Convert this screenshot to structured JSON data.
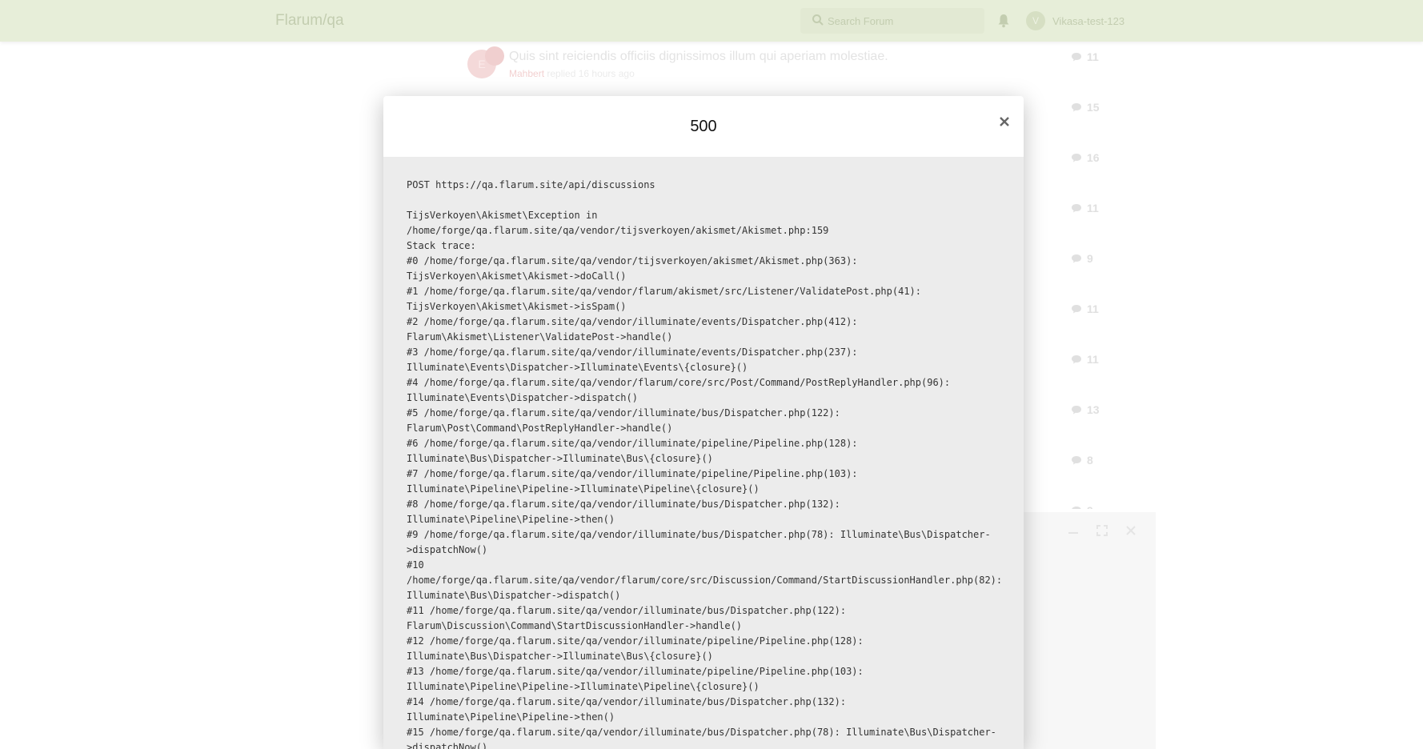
{
  "header": {
    "logo": "Flarum/qa",
    "search_placeholder": "Search Forum",
    "avatar_letter": "V",
    "username": "Vikasa-test-123"
  },
  "background_list": {
    "first_discussion": {
      "avatar_letter": "E",
      "title": "Quis sint reiciendis officiis dignissimos illum qui aperiam molestiae.",
      "tag": "Mahbert",
      "meta": " replied 16 hours ago"
    },
    "reply_counts": [
      "11",
      "15",
      "16",
      "11",
      "9",
      "11",
      "11",
      "13",
      "8",
      "9"
    ]
  },
  "modal": {
    "title": "500",
    "request": "POST https://qa.flarum.site/api/discussions",
    "trace_lines": [
      "TijsVerkoyen\\Akismet\\Exception in",
      "/home/forge/qa.flarum.site/qa/vendor/tijsverkoyen/akismet/Akismet.php:159",
      "Stack trace:",
      "#0 /home/forge/qa.flarum.site/qa/vendor/tijsverkoyen/akismet/Akismet.php(363):",
      "TijsVerkoyen\\Akismet\\Akismet->doCall()",
      "#1 /home/forge/qa.flarum.site/qa/vendor/flarum/akismet/src/Listener/ValidatePost.php(41):",
      "TijsVerkoyen\\Akismet\\Akismet->isSpam()",
      "#2 /home/forge/qa.flarum.site/qa/vendor/illuminate/events/Dispatcher.php(412):",
      "Flarum\\Akismet\\Listener\\ValidatePost->handle()",
      "#3 /home/forge/qa.flarum.site/qa/vendor/illuminate/events/Dispatcher.php(237):",
      "Illuminate\\Events\\Dispatcher->Illuminate\\Events\\{closure}()",
      "#4 /home/forge/qa.flarum.site/qa/vendor/flarum/core/src/Post/Command/PostReplyHandler.php(96):",
      "Illuminate\\Events\\Dispatcher->dispatch()",
      "#5 /home/forge/qa.flarum.site/qa/vendor/illuminate/bus/Dispatcher.php(122):",
      "Flarum\\Post\\Command\\PostReplyHandler->handle()",
      "#6 /home/forge/qa.flarum.site/qa/vendor/illuminate/pipeline/Pipeline.php(128):",
      "Illuminate\\Bus\\Dispatcher->Illuminate\\Bus\\{closure}()",
      "#7 /home/forge/qa.flarum.site/qa/vendor/illuminate/pipeline/Pipeline.php(103):",
      "Illuminate\\Pipeline\\Pipeline->Illuminate\\Pipeline\\{closure}()",
      "#8 /home/forge/qa.flarum.site/qa/vendor/illuminate/bus/Dispatcher.php(132):",
      "Illuminate\\Pipeline\\Pipeline->then()",
      "#9 /home/forge/qa.flarum.site/qa/vendor/illuminate/bus/Dispatcher.php(78): Illuminate\\Bus\\Dispatcher-",
      ">dispatchNow()",
      "#10",
      "/home/forge/qa.flarum.site/qa/vendor/flarum/core/src/Discussion/Command/StartDiscussionHandler.php(82):",
      "Illuminate\\Bus\\Dispatcher->dispatch()",
      "#11 /home/forge/qa.flarum.site/qa/vendor/illuminate/bus/Dispatcher.php(122):",
      "Flarum\\Discussion\\Command\\StartDiscussionHandler->handle()",
      "#12 /home/forge/qa.flarum.site/qa/vendor/illuminate/pipeline/Pipeline.php(128):",
      "Illuminate\\Bus\\Dispatcher->Illuminate\\Bus\\{closure}()",
      "#13 /home/forge/qa.flarum.site/qa/vendor/illuminate/pipeline/Pipeline.php(103):",
      "Illuminate\\Pipeline\\Pipeline->Illuminate\\Pipeline\\{closure}()",
      "#14 /home/forge/qa.flarum.site/qa/vendor/illuminate/bus/Dispatcher.php(132):",
      "Illuminate\\Pipeline\\Pipeline->then()",
      "#15 /home/forge/qa.flarum.site/qa/vendor/illuminate/bus/Dispatcher.php(78): Illuminate\\Bus\\Dispatcher-",
      ">dispatchNow()"
    ]
  },
  "icons": {
    "search": "search-icon",
    "bell": "bell-icon",
    "comment": "comment-icon",
    "close": "close-icon",
    "minimize": "minimize-icon",
    "fullscreen": "fullscreen-icon"
  }
}
